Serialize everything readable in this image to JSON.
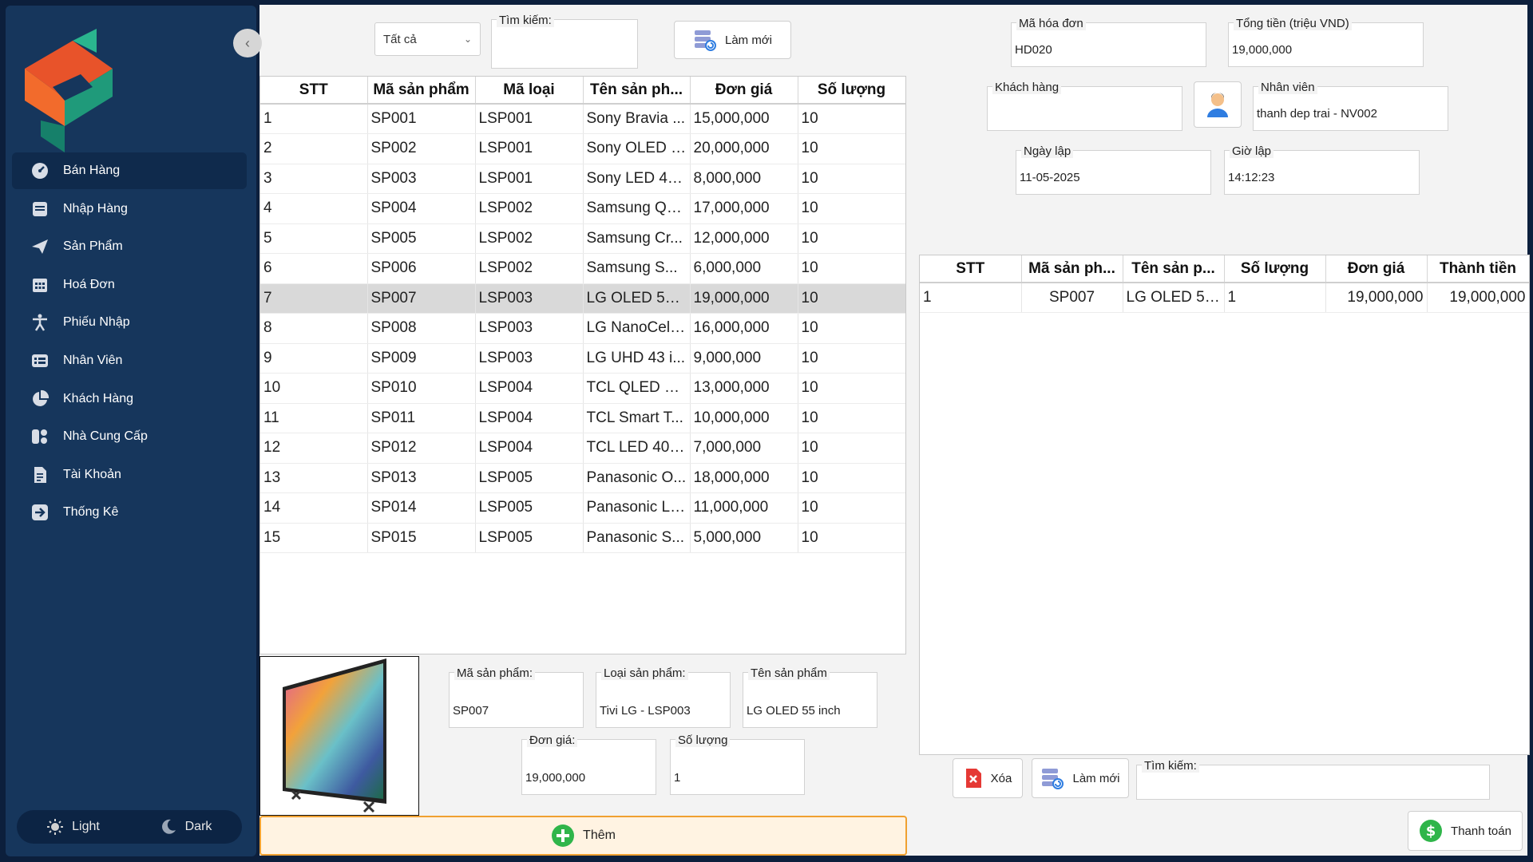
{
  "sidebar": {
    "items": [
      {
        "label": "Bán Hàng",
        "icon": "dashboard-gauge-icon",
        "active": true
      },
      {
        "label": "Nhập Hàng",
        "icon": "inbox-tray-icon"
      },
      {
        "label": "Sản Phẩm",
        "icon": "paper-plane-icon"
      },
      {
        "label": "Hoá Đơn",
        "icon": "calendar-grid-icon"
      },
      {
        "label": "Phiếu Nhập",
        "icon": "accessibility-person-icon"
      },
      {
        "label": "Nhân Viên",
        "icon": "list-card-icon"
      },
      {
        "label": "Khách Hàng",
        "icon": "pie-chart-icon"
      },
      {
        "label": "Nhà Cung Cấp",
        "icon": "supplier-blocks-icon"
      },
      {
        "label": "Tài Khoản",
        "icon": "document-icon"
      },
      {
        "label": "Thống Kê",
        "icon": "arrow-right-box-icon"
      }
    ],
    "theme": {
      "light": "Light",
      "dark": "Dark"
    }
  },
  "filter": {
    "category_selected": "Tất cả",
    "search_label": "Tìm kiếm:",
    "search_value": "",
    "refresh_label": "Làm mới"
  },
  "products": {
    "columns": [
      "STT",
      "Mã sản phẩm",
      "Mã loại",
      "Tên sản ph...",
      "Đơn giá",
      "Số lượng"
    ],
    "rows": [
      [
        "1",
        "SP001",
        "LSP001",
        "Sony Bravia ...",
        "15,000,000",
        "10"
      ],
      [
        "2",
        "SP002",
        "LSP001",
        "Sony OLED 6...",
        "20,000,000",
        "10"
      ],
      [
        "3",
        "SP003",
        "LSP001",
        "Sony LED 43...",
        "8,000,000",
        "10"
      ],
      [
        "4",
        "SP004",
        "LSP002",
        "Samsung QL...",
        "17,000,000",
        "10"
      ],
      [
        "5",
        "SP005",
        "LSP002",
        "Samsung Cr...",
        "12,000,000",
        "10"
      ],
      [
        "6",
        "SP006",
        "LSP002",
        "Samsung S...",
        "6,000,000",
        "10"
      ],
      [
        "7",
        "SP007",
        "LSP003",
        "LG OLED 55 i...",
        "19,000,000",
        "10"
      ],
      [
        "8",
        "SP008",
        "LSP003",
        "LG NanoCell ...",
        "16,000,000",
        "10"
      ],
      [
        "9",
        "SP009",
        "LSP003",
        "LG UHD 43 i...",
        "9,000,000",
        "10"
      ],
      [
        "10",
        "SP010",
        "LSP004",
        "TCL QLED 55...",
        "13,000,000",
        "10"
      ],
      [
        "11",
        "SP011",
        "LSP004",
        "TCL Smart T...",
        "10,000,000",
        "10"
      ],
      [
        "12",
        "SP012",
        "LSP004",
        "TCL LED 40 i...",
        "7,000,000",
        "10"
      ],
      [
        "13",
        "SP013",
        "LSP005",
        "Panasonic O...",
        "18,000,000",
        "10"
      ],
      [
        "14",
        "SP014",
        "LSP005",
        "Panasonic LE...",
        "11,000,000",
        "10"
      ],
      [
        "15",
        "SP015",
        "LSP005",
        "Panasonic S...",
        "5,000,000",
        "10"
      ]
    ],
    "selected_index": 6
  },
  "detail": {
    "code_label": "Mã sản phẩm:",
    "code_value": "SP007",
    "type_label": "Loại sản phẩm:",
    "type_value": "Tivi LG - LSP003",
    "name_label": "Tên sản phẩm",
    "name_value": "LG OLED 55 inch",
    "price_label": "Đơn giá:",
    "price_value": "19,000,000",
    "qty_label": "Số lượng",
    "qty_value": "1",
    "add_label": "Thêm"
  },
  "invoice": {
    "id_label": "Mã hóa đơn",
    "id_value": "HD020",
    "total_label": "Tổng tiền (triệu VND)",
    "total_value": "19,000,000",
    "customer_label": "Khách hàng",
    "customer_value": "",
    "staff_label": "Nhân viên",
    "staff_value": "thanh dep trai - NV002",
    "date_label": "Ngày lập",
    "date_value": "11-05-2025",
    "time_label": "Giờ lập",
    "time_value": "14:12:23"
  },
  "cart": {
    "columns": [
      "STT",
      "Mã sản ph...",
      "Tên sản p...",
      "Số lượng",
      "Đơn giá",
      "Thành tiền"
    ],
    "rows": [
      [
        "1",
        "SP007",
        "LG OLED 55...",
        "1",
        "19,000,000",
        "19,000,000"
      ]
    ]
  },
  "cart_actions": {
    "delete_label": "Xóa",
    "refresh_label": "Làm mới",
    "search_label": "Tìm kiếm:",
    "search_value": "",
    "pay_label": "Thanh toán"
  },
  "colors": {
    "sidebar_bg": "#16365c",
    "accent_orange": "#f0a030",
    "add_green": "#2fb54a",
    "delete_red": "#e53935"
  }
}
